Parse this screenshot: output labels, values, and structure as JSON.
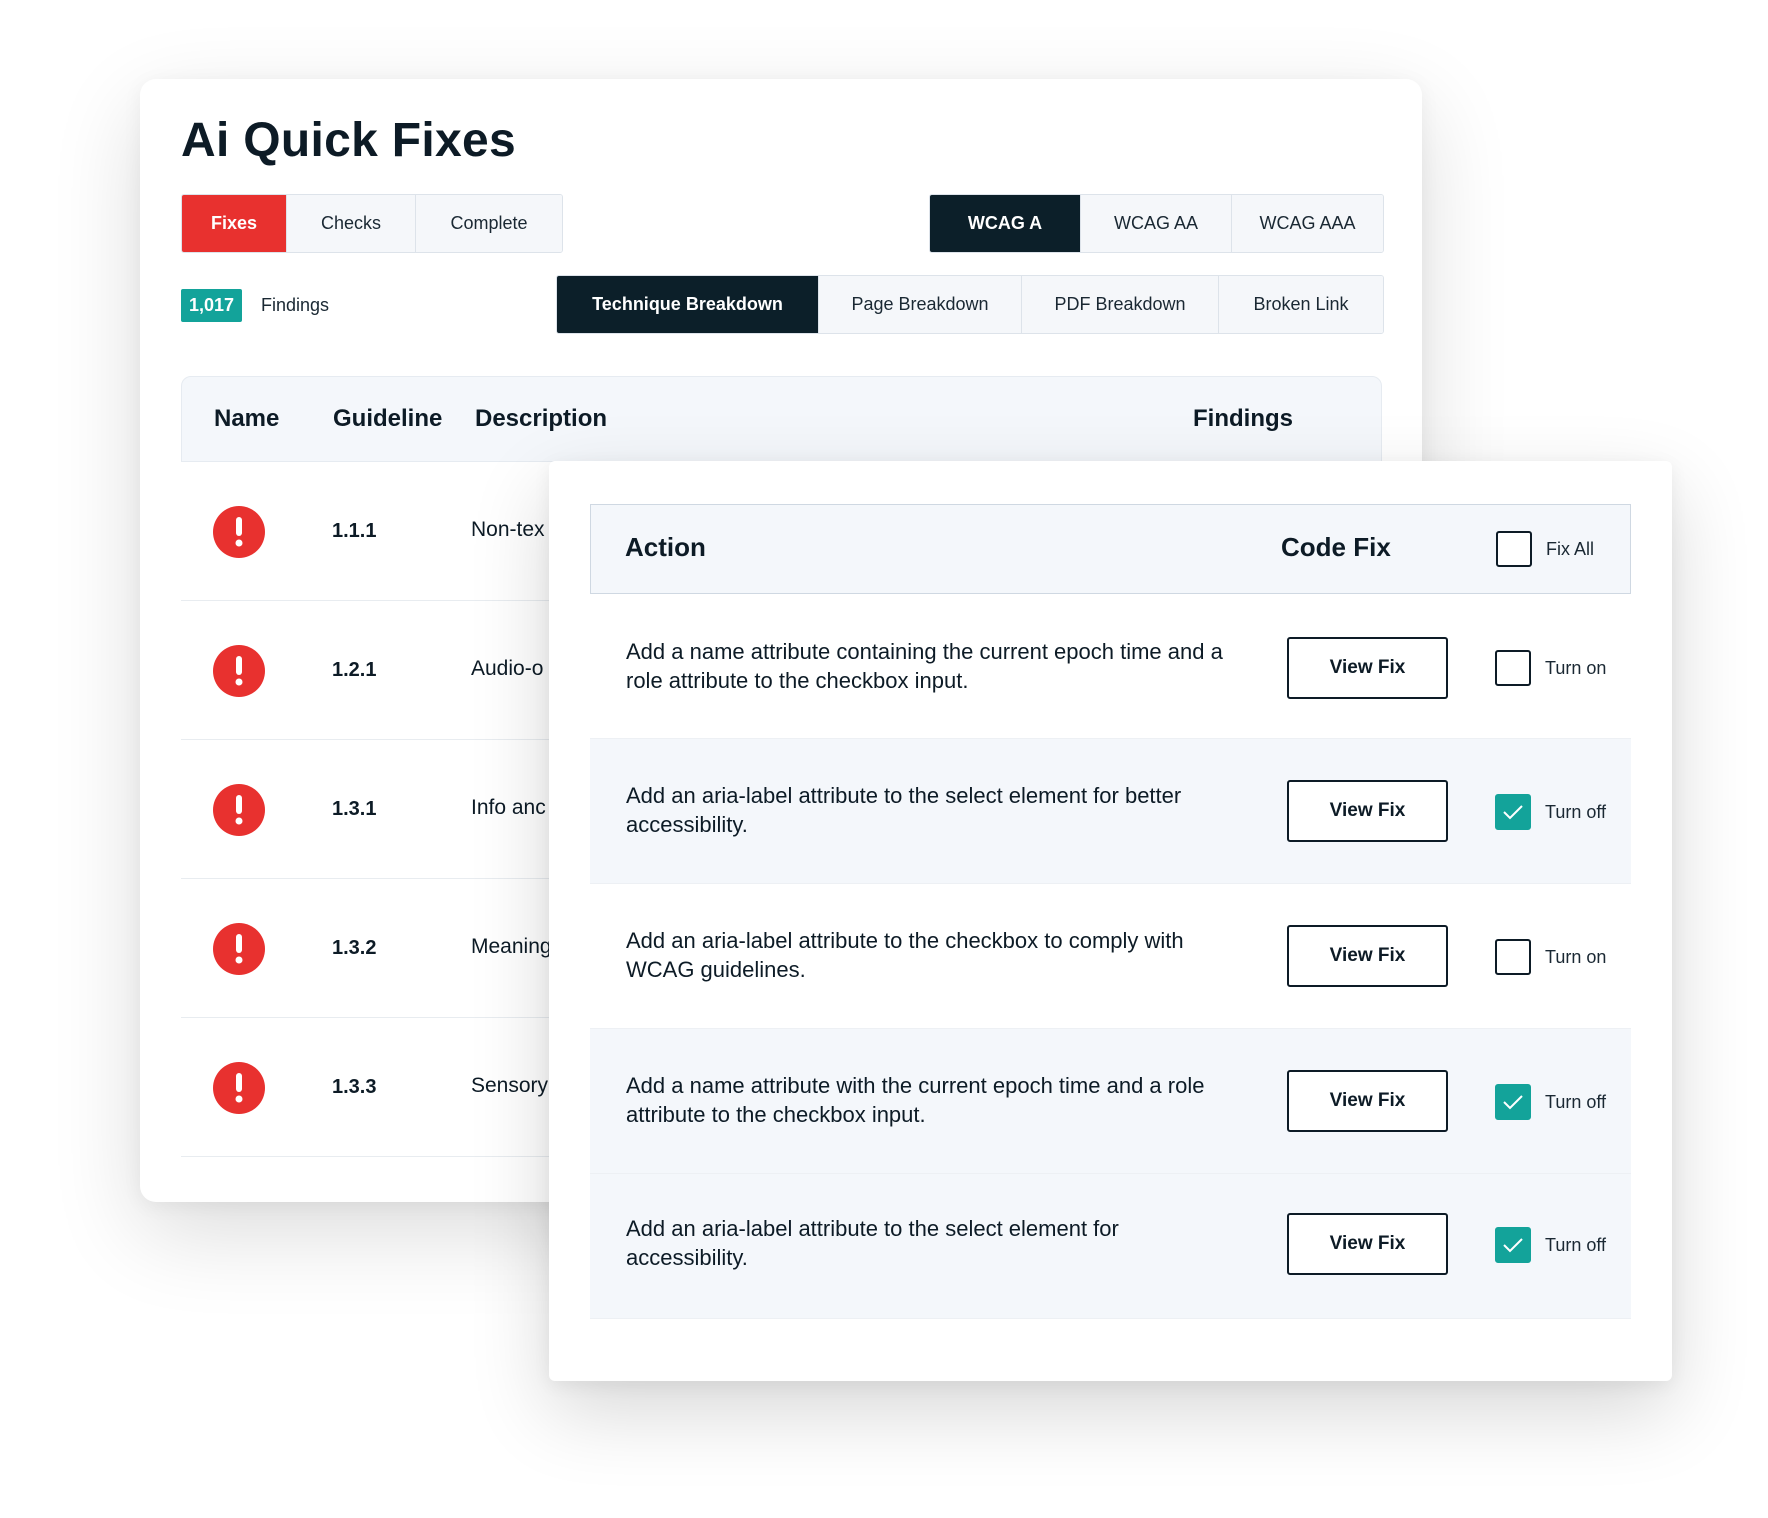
{
  "title": "Ai Quick Fixes",
  "status_tabs": [
    "Fixes",
    "Checks",
    "Complete"
  ],
  "wcag_tabs": [
    "WCAG A",
    "WCAG AA",
    "WCAG AAA"
  ],
  "findings": {
    "count": "1,017",
    "label": "Findings"
  },
  "breakdown_tabs": [
    "Technique Breakdown",
    "Page Breakdown",
    "PDF Breakdown",
    "Broken Link"
  ],
  "table": {
    "headers": {
      "name": "Name",
      "guideline": "Guideline",
      "description": "Description",
      "findings": "Findings"
    },
    "rows": [
      {
        "guideline": "1.1.1",
        "description": "Non-tex"
      },
      {
        "guideline": "1.2.1",
        "description": "Audio-o"
      },
      {
        "guideline": "1.3.1",
        "description": "Info anc"
      },
      {
        "guideline": "1.3.2",
        "description": "Meaning"
      },
      {
        "guideline": "1.3.3",
        "description": "Sensory"
      }
    ]
  },
  "fix_panel": {
    "headers": {
      "action": "Action",
      "code_fix": "Code Fix",
      "fix_all": "Fix All"
    },
    "fix_all_checked": false,
    "button_label": "View Fix",
    "rows": [
      {
        "action": "Add a name attribute containing the current epoch time and a role attribute to the checkbox input.",
        "checked": false,
        "toggle_label": "Turn on"
      },
      {
        "action": "Add an aria-label attribute to the select element for better accessibility.",
        "checked": true,
        "toggle_label": "Turn off"
      },
      {
        "action": "Add an aria-label attribute to the checkbox to comply with WCAG guidelines.",
        "checked": false,
        "toggle_label": "Turn on"
      },
      {
        "action": "Add a name attribute with the current epoch time and a role attribute to the checkbox input.",
        "checked": true,
        "toggle_label": "Turn off"
      },
      {
        "action": "Add an aria-label attribute to the select element for accessibility.",
        "checked": true,
        "toggle_label": "Turn off"
      }
    ]
  },
  "colors": {
    "accent_red": "#e8312f",
    "accent_teal": "#13a39a",
    "dark": "#0c1f29"
  },
  "icons": {
    "row_status": "alert-icon",
    "check": "checkmark-icon"
  }
}
